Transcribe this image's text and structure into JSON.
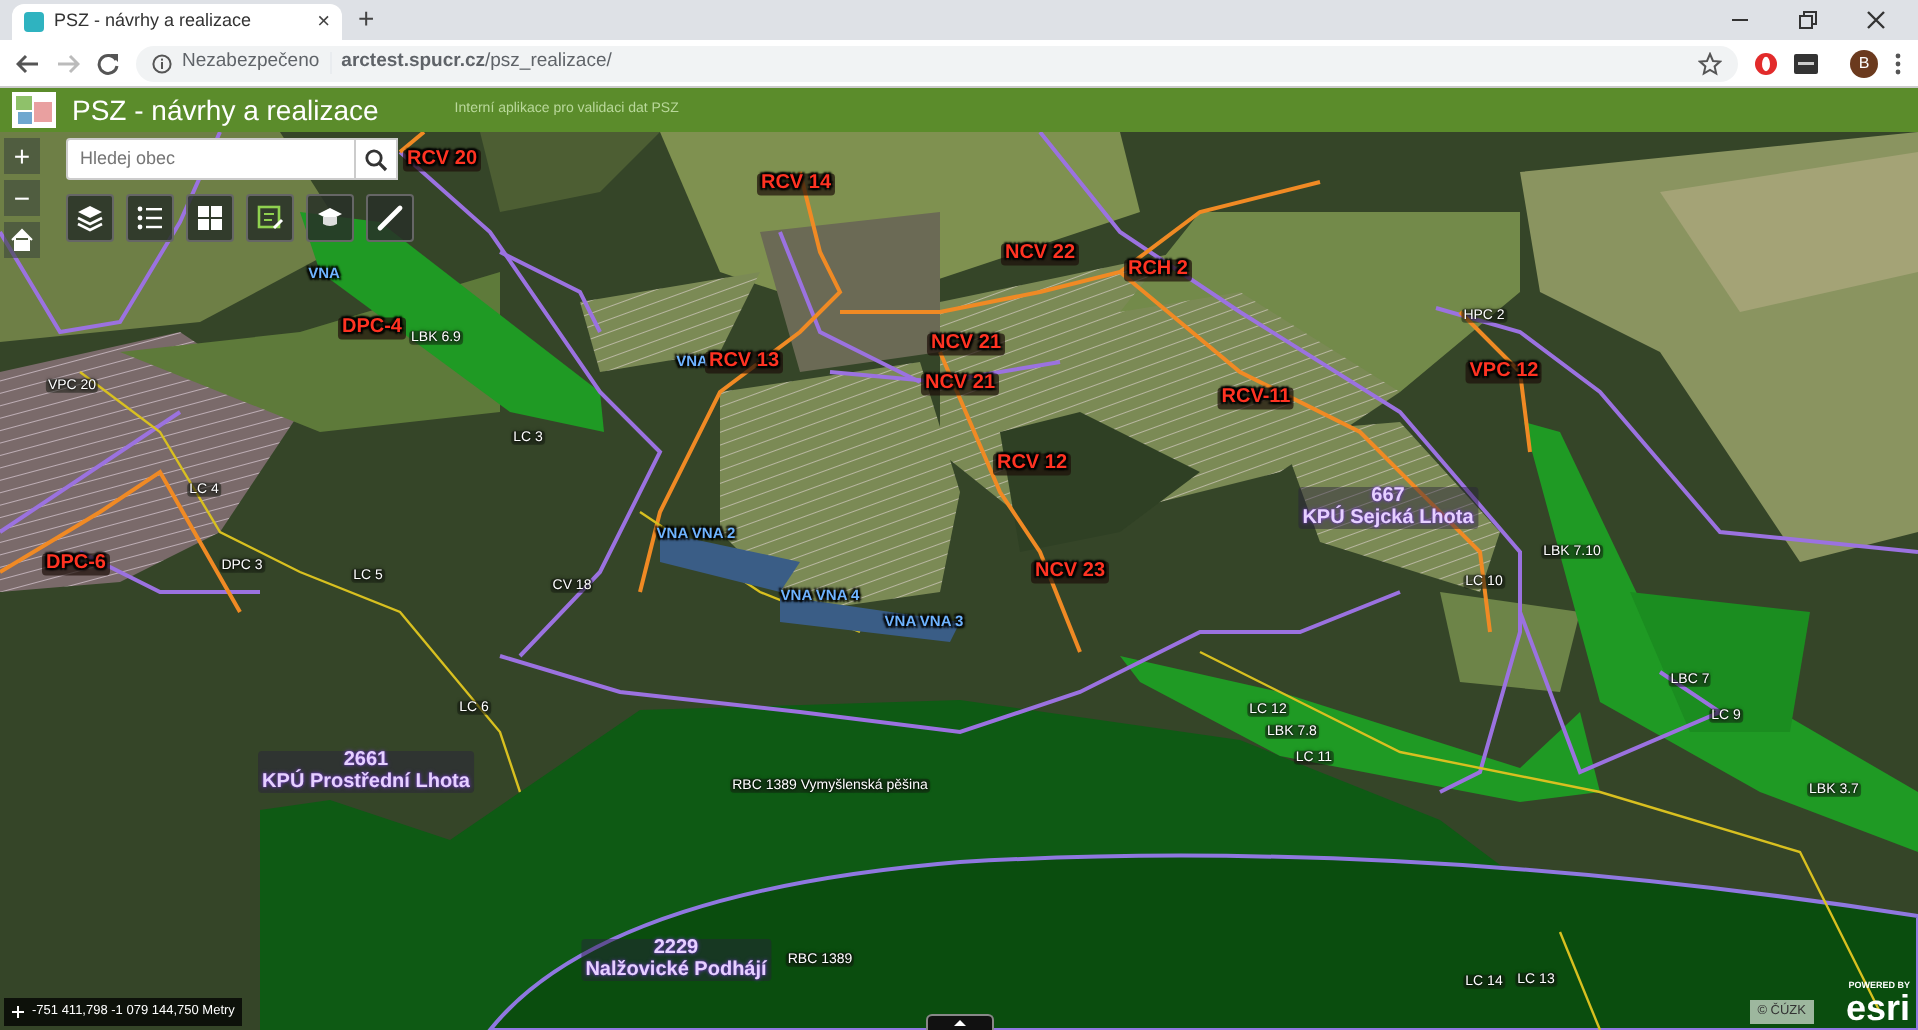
{
  "browser": {
    "tab": {
      "title": "PSZ - návrhy a realizace",
      "close": "×"
    },
    "new_tab": "+",
    "address_bar": {
      "security_label": "Nezabezpečeno",
      "url": "**arctest.spucr.cz**/psz_realizace/"
    },
    "profile_initial": "B"
  },
  "app": {
    "title": "PSZ - návrhy a realizace",
    "subtitle": "Interní aplikace pro validaci dat PSZ"
  },
  "search": {
    "placeholder": "Hledej obec"
  },
  "zoom": {
    "zoom_in": "+",
    "zoom_out": "−"
  },
  "map": {
    "labels": [
      {
        "kind": "road",
        "text": "RCV 20"
      },
      {
        "kind": "road",
        "text": "RCV 14"
      },
      {
        "kind": "water",
        "text": "VNA"
      },
      {
        "kind": "road",
        "text": "DPC-4"
      },
      {
        "kind": "feature",
        "text": "LBK 6.9"
      },
      {
        "kind": "road",
        "text": "NCV 22"
      },
      {
        "kind": "road",
        "text": "RCH 2"
      },
      {
        "kind": "feature",
        "text": "HPC 2"
      },
      {
        "kind": "road",
        "text": "NCV 21"
      },
      {
        "kind": "water",
        "text": "VNA"
      },
      {
        "kind": "road",
        "text": "RCV 13"
      },
      {
        "kind": "road",
        "text": "NCV 21"
      },
      {
        "kind": "feature",
        "text": "VPC 20"
      },
      {
        "kind": "road",
        "text": "VPC 12"
      },
      {
        "kind": "road",
        "text": "RCV-11"
      },
      {
        "kind": "feature",
        "text": "LC 3"
      },
      {
        "kind": "road",
        "text": "RCV 12"
      },
      {
        "kind": "feature",
        "text": "LC 4"
      },
      {
        "kind": "area",
        "code": "667",
        "text": "KPÚ Sejcká Lhota"
      },
      {
        "kind": "water",
        "text": "VNA VNA 2"
      },
      {
        "kind": "feature",
        "text": "LBK 7.10"
      },
      {
        "kind": "road",
        "text": "DPC-6"
      },
      {
        "kind": "feature",
        "text": "DPC 3"
      },
      {
        "kind": "feature",
        "text": "LC 5"
      },
      {
        "kind": "road",
        "text": "NCV 23"
      },
      {
        "kind": "feature",
        "text": "CV 18"
      },
      {
        "kind": "feature",
        "text": "LC 10"
      },
      {
        "kind": "water",
        "text": "VNA VNA 4"
      },
      {
        "kind": "water",
        "text": "VNA VNA 3"
      },
      {
        "kind": "feature",
        "text": "LBC 7"
      },
      {
        "kind": "feature",
        "text": "LC 6"
      },
      {
        "kind": "feature",
        "text": "LC 12"
      },
      {
        "kind": "feature",
        "text": "LC 9"
      },
      {
        "kind": "feature",
        "text": "LBK 7.8"
      },
      {
        "kind": "feature",
        "text": "LC 11"
      },
      {
        "kind": "area",
        "code": "2661",
        "text": "KPÚ Prostřední Lhota"
      },
      {
        "kind": "feature",
        "text": "RBC 1389 Vymyšlenská pěšina"
      },
      {
        "kind": "feature",
        "text": "LBK 3.7"
      },
      {
        "kind": "area",
        "code": "2229",
        "text": "Nalžovické Podhájí"
      },
      {
        "kind": "feature",
        "text": "RBC 1389"
      },
      {
        "kind": "feature",
        "text": "LC 14"
      },
      {
        "kind": "feature",
        "text": "LC 13"
      }
    ],
    "coordinates": "-751 411,798 -1 079 144,750 Metry",
    "attribution": "© ČÚZK",
    "logo_caption": "POWERED BY",
    "logo": "esri"
  }
}
